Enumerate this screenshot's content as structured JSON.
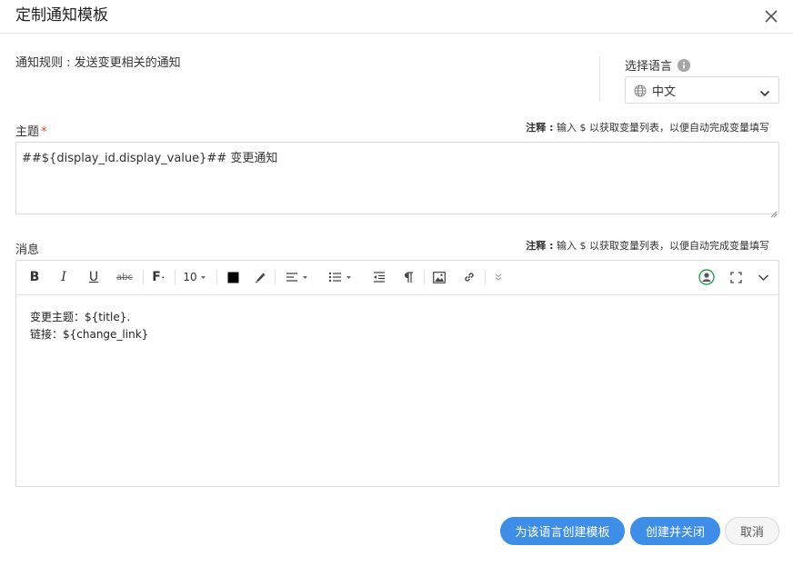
{
  "dialog": {
    "title": "定制通知模板"
  },
  "rule": {
    "text": "通知规则 : 发送变更相关的通知"
  },
  "language": {
    "label": "选择语言",
    "selected": "中文"
  },
  "subject": {
    "label": "主题",
    "required_mark": "*",
    "note_prefix": "注释 :",
    "note_text": " 输入 $ 以获取变量列表，以便自动完成变量填写",
    "value": "##${display_id.display_value}## 变更通知"
  },
  "message": {
    "label": "消息",
    "note_prefix": "注释 :",
    "note_text": " 输入 $ 以获取变量列表，以便自动完成变量填写",
    "toolbar": {
      "bold": "B",
      "italic": "I",
      "underline": "U",
      "strike": "abc",
      "font": "F",
      "font_size": "10"
    },
    "body_lines": [
      "变更主题：${title}.",
      "链接：${change_link}"
    ]
  },
  "buttons": {
    "create_lang_template": "为该语言创建模板",
    "create_and_close": "创建并关闭",
    "cancel": "取消"
  },
  "colors": {
    "primary": "#3e8ee8",
    "required": "#e53935",
    "border": "#d9d9d9"
  }
}
